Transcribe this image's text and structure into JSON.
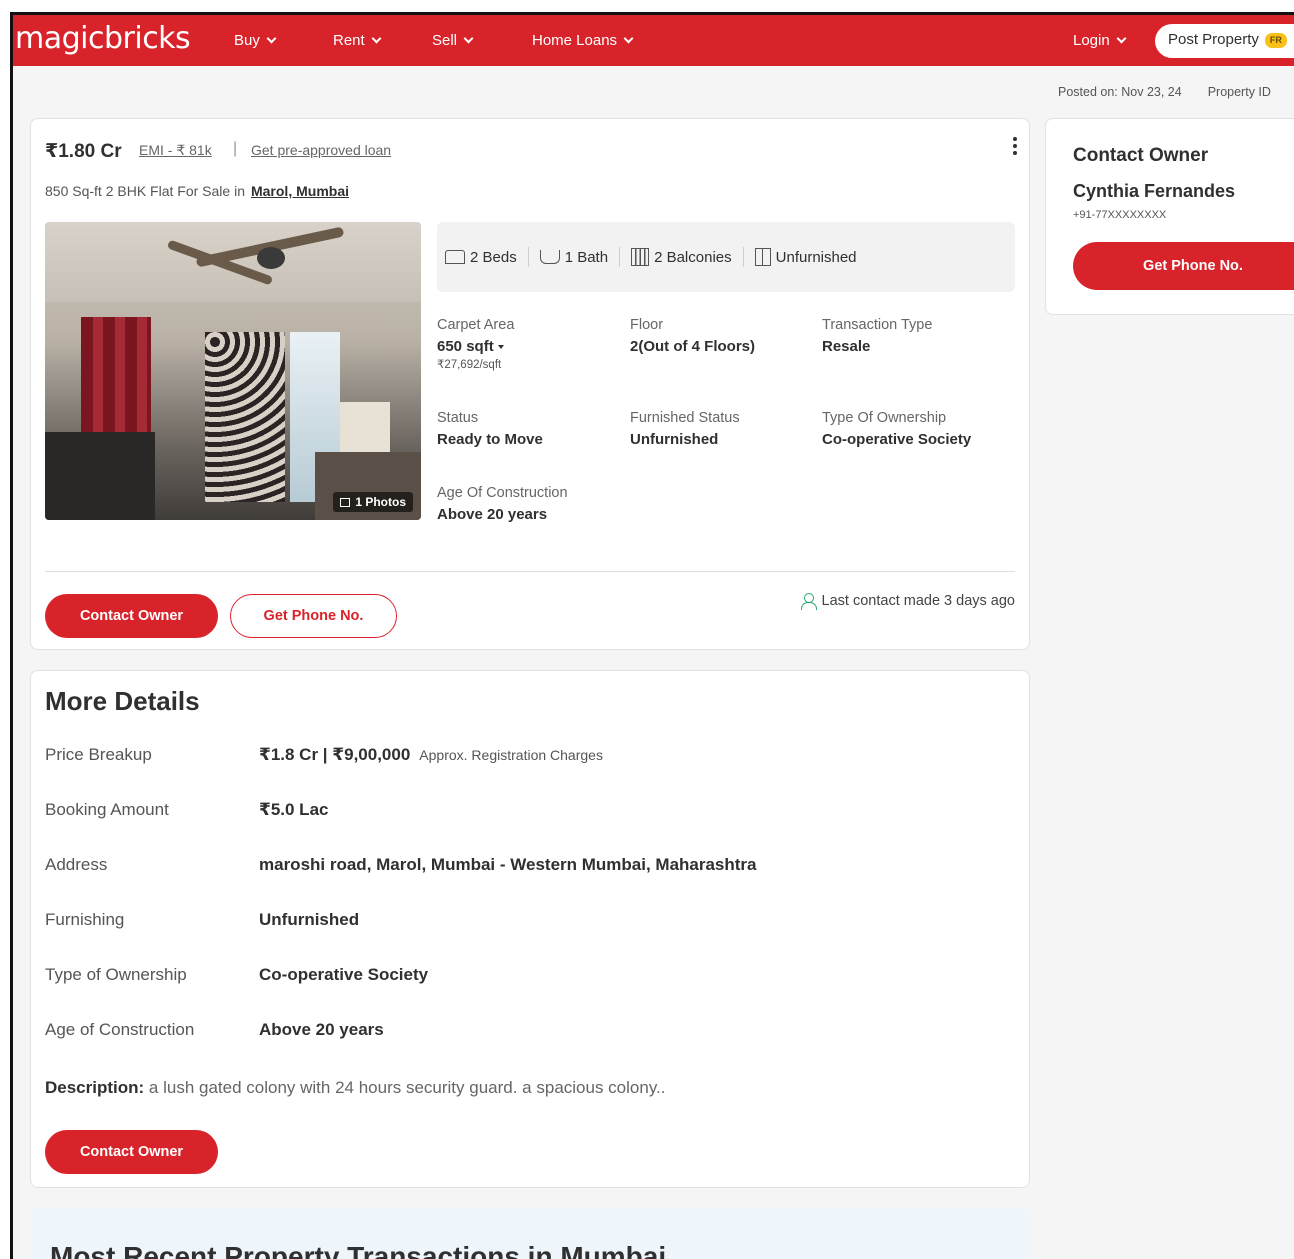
{
  "header": {
    "logo": "magicbricks",
    "nav": [
      "Buy",
      "Rent",
      "Sell",
      "Home Loans"
    ],
    "login": "Login",
    "post_property": "Post Property",
    "free_badge": "FR",
    "brand_color": "#d8232a"
  },
  "posted": {
    "posted_on": "Posted on: Nov 23, 24",
    "property_id": "Property ID"
  },
  "listing": {
    "price": "₹1.80 Cr",
    "emi": "EMI - ₹ 81k",
    "separator": "|",
    "preapproved": "Get pre-approved loan",
    "subtitle": "850 Sq-ft 2 BHK Flat For Sale in",
    "location": "Marol, Mumbai",
    "photos_badge": "1 Photos",
    "amenities": {
      "beds": "2 Beds",
      "bath": "1 Bath",
      "balconies": "2 Balconies",
      "furnishing": "Unfurnished"
    },
    "specs": {
      "carpet_label": "Carpet Area",
      "carpet_value": "650 sqft",
      "carpet_rate": "₹27,692/sqft",
      "floor_label": "Floor",
      "floor_value": "2(Out of 4 Floors)",
      "transaction_label": "Transaction Type",
      "transaction_value": "Resale",
      "status_label": "Status",
      "status_value": "Ready to Move",
      "furnished_label": "Furnished Status",
      "furnished_value": "Unfurnished",
      "ownership_label": "Type Of Ownership",
      "ownership_value": "Co-operative Society",
      "age_label": "Age Of Construction",
      "age_value": "Above 20 years"
    },
    "contact_owner": "Contact Owner",
    "get_phone": "Get Phone No.",
    "last_contact": "Last contact made 3 days ago"
  },
  "more_details": {
    "title": "More Details",
    "price_label": "Price Breakup",
    "price_value": "₹1.8 Cr | ₹9,00,000",
    "price_note": "Approx. Registration Charges",
    "booking_label": "Booking Amount",
    "booking_value": "₹5.0 Lac",
    "address_label": "Address",
    "address_value": "maroshi road, Marol, Mumbai - Western Mumbai, Maharashtra",
    "furnishing_label": "Furnishing",
    "furnishing_value": "Unfurnished",
    "ownership_label": "Type of Ownership",
    "ownership_value": "Co-operative Society",
    "age_label": "Age of Construction",
    "age_value": "Above 20 years",
    "description_label": "Description:",
    "description_text": " a lush gated colony with 24 hours security guard. a spacious colony..",
    "contact_owner": "Contact Owner"
  },
  "contact_card": {
    "title": "Contact Owner",
    "name": "Cynthia Fernandes",
    "phone": "+91-77XXXXXXXX",
    "get_phone": "Get Phone No."
  },
  "recent": {
    "title": "Most Recent Property Transactions in Mumbai"
  }
}
